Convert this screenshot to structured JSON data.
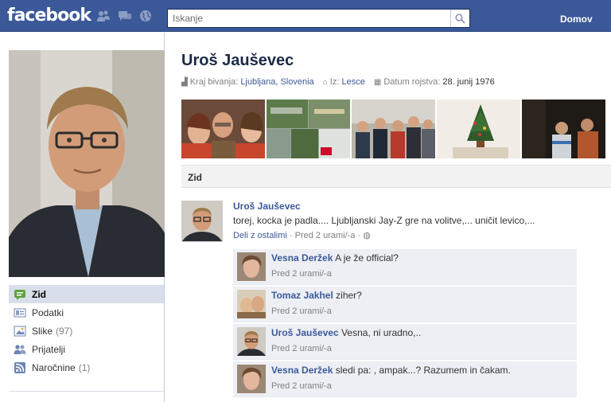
{
  "topbar": {
    "logo": "facebook",
    "search_placeholder": "Iskanje",
    "home_label": "Domov",
    "jewels": [
      "friend-requests-icon",
      "messages-icon",
      "notifications-globe-icon"
    ]
  },
  "sidebar": {
    "items": [
      {
        "label": "Zid",
        "count": "",
        "icon": "wall-icon",
        "active": true
      },
      {
        "label": "Podatki",
        "count": "",
        "icon": "info-icon",
        "active": false
      },
      {
        "label": "Slike",
        "count": "(97)",
        "icon": "photos-icon",
        "active": false
      },
      {
        "label": "Prijatelji",
        "count": "",
        "icon": "friends-icon",
        "active": false
      },
      {
        "label": "Naročnine",
        "count": "(1)",
        "icon": "rss-icon",
        "active": false
      }
    ]
  },
  "profile": {
    "name": "Uroš Jauševec",
    "residence_label": "Kraj bivanja:",
    "residence_value": "Ljubljana, Slovenia",
    "from_label": "Iz:",
    "from_value": "Lesce",
    "birthday_label": "Datum rojstva:",
    "birthday_value": "28. junij 1976"
  },
  "wall": {
    "heading": "Zid",
    "post": {
      "author": "Uroš Jauševec",
      "text": "torej, kocka je padla.... Ljubljanski Jay-Z gre na volitve,... uničit levico,...",
      "share_label": "Deli z ostalimi",
      "time": "· Pred 2 urami/-a ·"
    },
    "comments": [
      {
        "author": "Vesna Deržek",
        "text": "A je že official?",
        "time": "Pred 2 urami/-a"
      },
      {
        "author": "Tomaz Jakhel",
        "text": "ziher?",
        "time": "Pred 2 urami/-a"
      },
      {
        "author": "Uroš Jauševec",
        "text": "Vesna, ni uradno,..",
        "time": "Pred 2 urami/-a"
      },
      {
        "author": "Vesna Deržek",
        "text": "sledi pa: , ampak...? Razumem in čakam.",
        "time": "Pred 2 urami/-a"
      }
    ]
  },
  "colors": {
    "brand": "#3b5998",
    "active_nav": "#d8dfea",
    "comment_bg": "#edeff4"
  }
}
